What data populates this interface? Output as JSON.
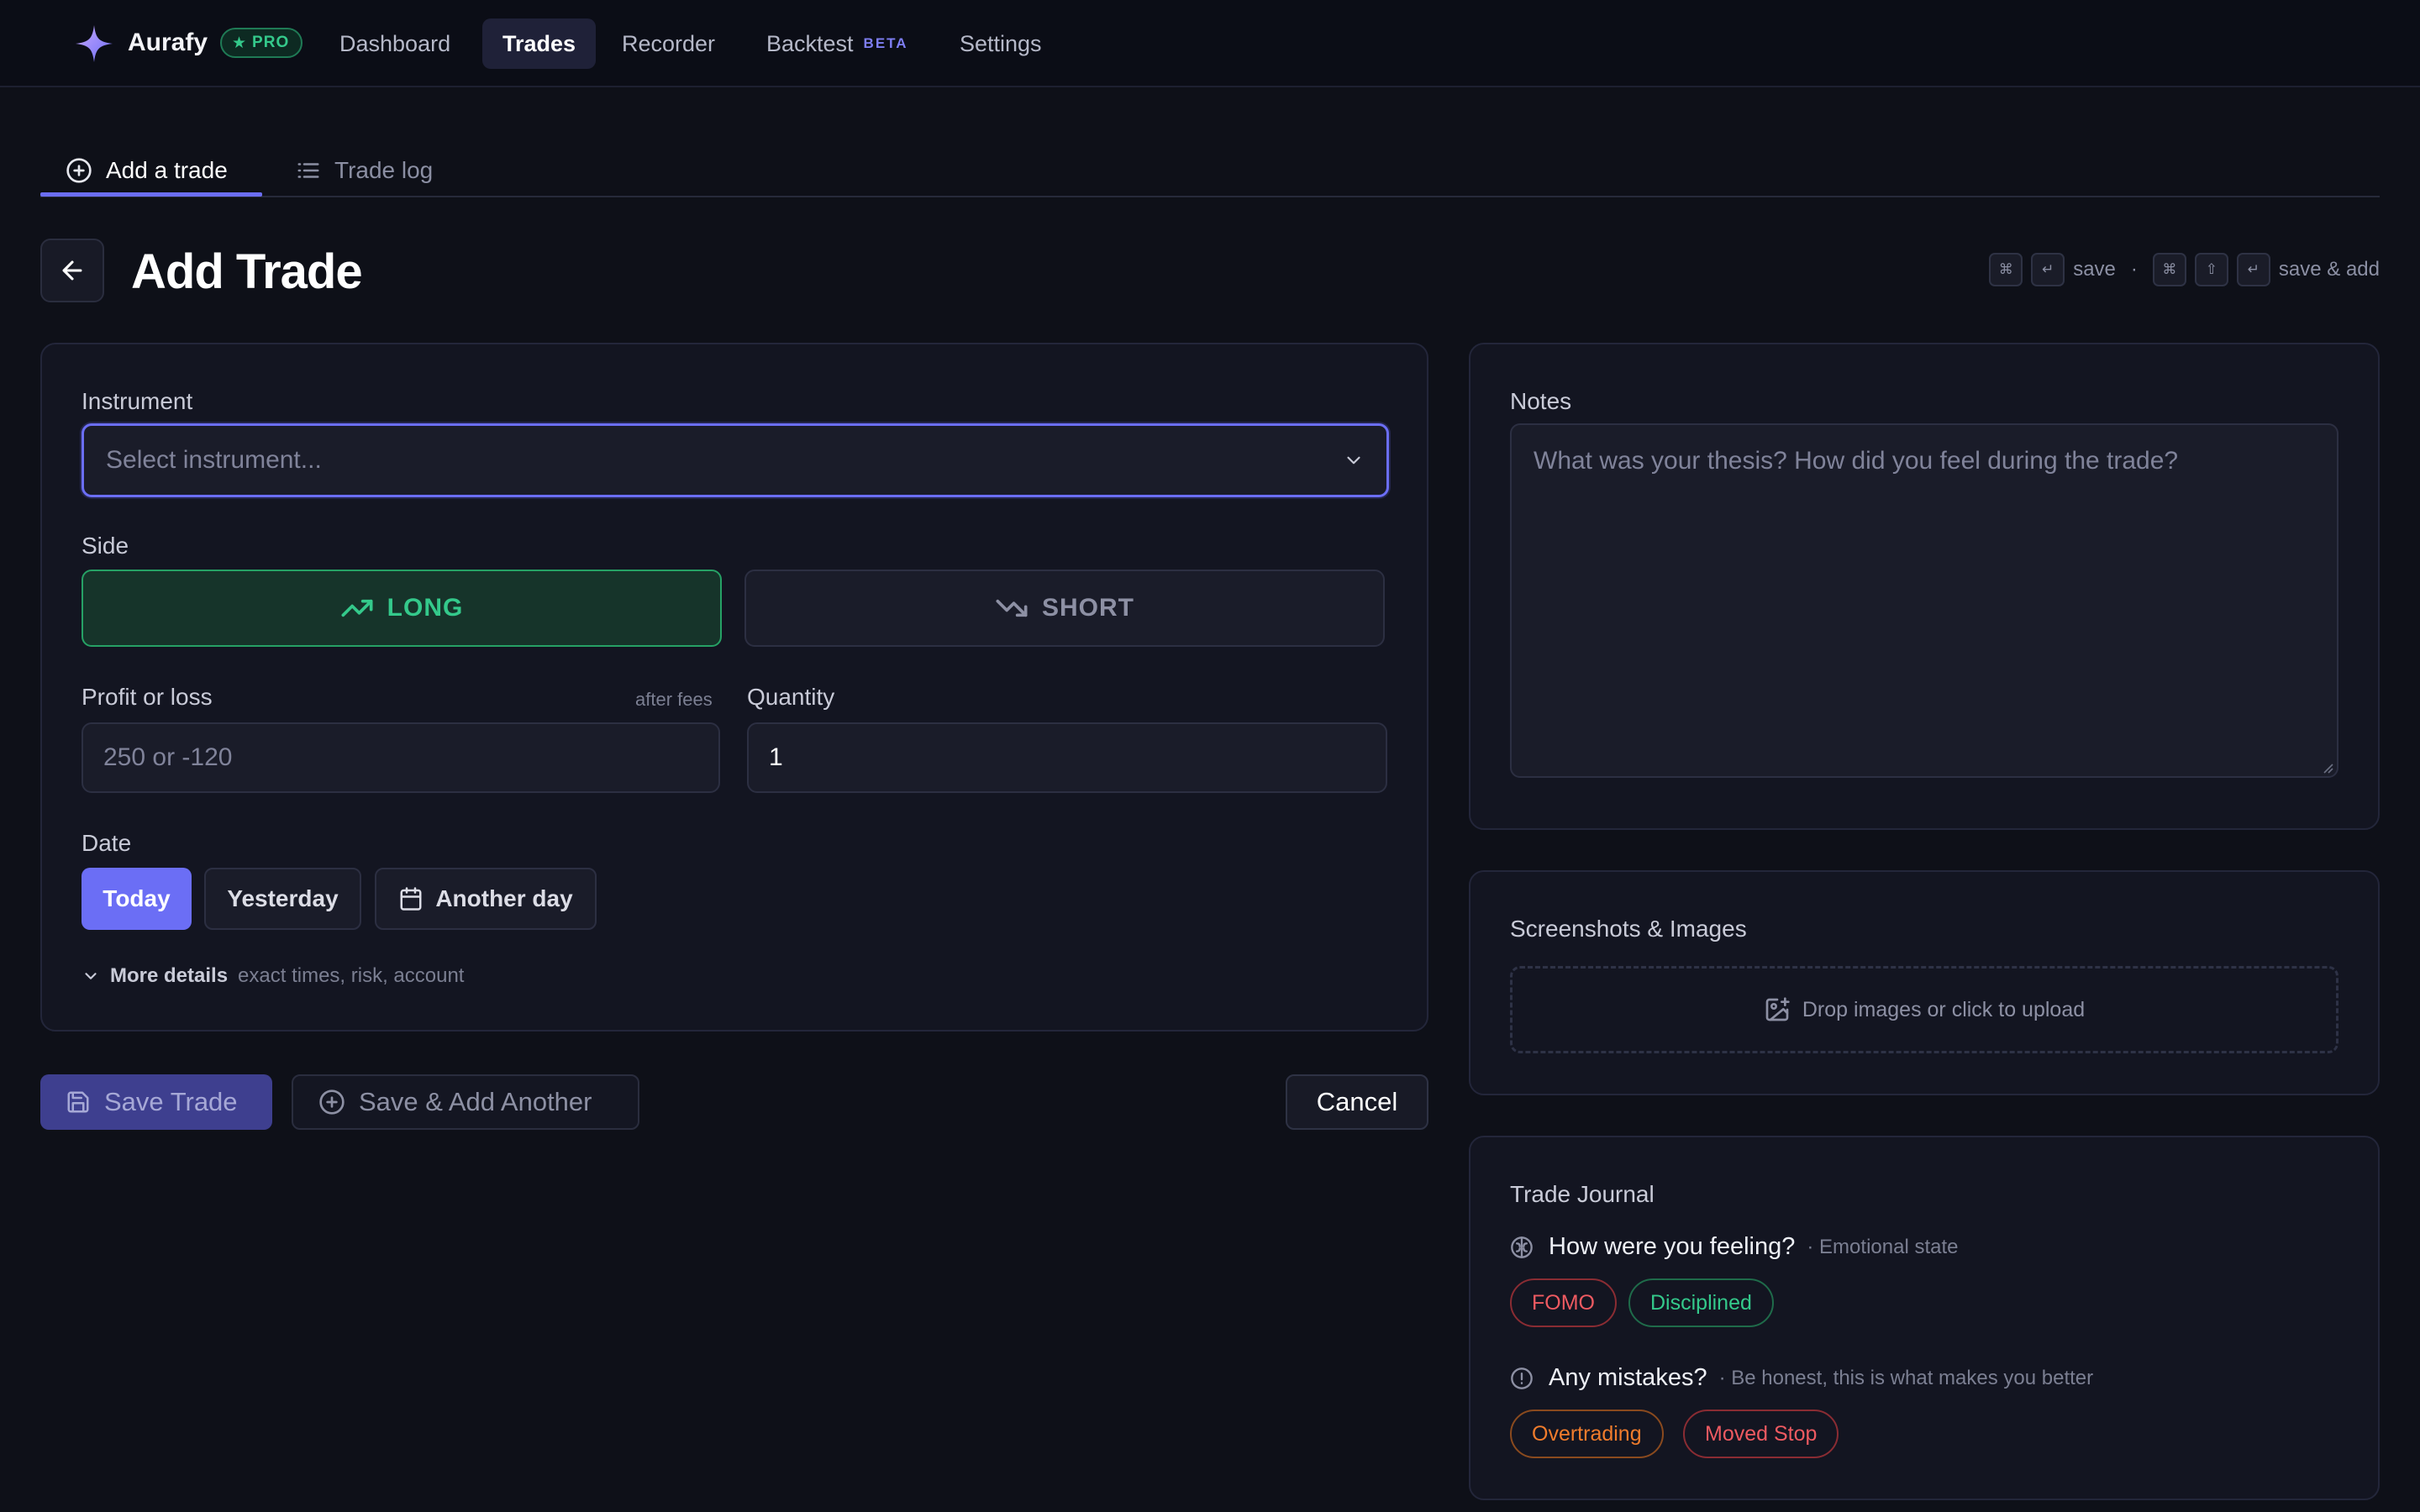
{
  "app": {
    "brand": "Aurafy",
    "plan_badge": "PRO",
    "nav": [
      {
        "label": "Dashboard"
      },
      {
        "label": "Trades"
      },
      {
        "label": "Recorder"
      },
      {
        "label": "Backtest",
        "tag": "BETA"
      },
      {
        "label": "Settings"
      }
    ],
    "active_nav": "Trades"
  },
  "tabs": [
    {
      "label": "Add a trade",
      "icon": "plus-circle-icon"
    },
    {
      "label": "Trade log",
      "icon": "list-icon"
    }
  ],
  "header": {
    "title": "Add Trade",
    "shortcut_save": "save",
    "shortcut_separator": "·",
    "shortcut_save_add": "save & add",
    "keys_save": [
      "⌘",
      "↵"
    ],
    "keys_save_add": [
      "⌘",
      "⇧",
      "↵"
    ]
  },
  "form": {
    "instrument_label": "Instrument",
    "instrument_placeholder": "Select instrument...",
    "side_label": "Side",
    "side_long": "LONG",
    "side_short": "SHORT",
    "pnl_label": "Profit or loss",
    "pnl_hint": "after fees",
    "pnl_placeholder": "250 or -120",
    "quantity_label": "Quantity",
    "quantity_value": "1",
    "date_label": "Date",
    "date_today": "Today",
    "date_yesterday": "Yesterday",
    "date_another": "Another day",
    "more_details": "More details",
    "more_details_hint": "exact times, risk, account"
  },
  "actions": {
    "save": "Save Trade",
    "save_add": "Save & Add Another",
    "cancel": "Cancel"
  },
  "notes": {
    "label": "Notes",
    "placeholder": "What was your thesis? How did you feel during the trade?"
  },
  "images": {
    "label": "Screenshots & Images",
    "dropzone": "Drop images or click to upload"
  },
  "journal": {
    "label": "Trade Journal",
    "feeling_q": "How were you feeling?",
    "feeling_hint": "· Emotional state",
    "feeling_chips": [
      "FOMO",
      "Disciplined"
    ],
    "mistakes_q": "Any mistakes?",
    "mistakes_hint": "· Be honest, this is what makes you better",
    "mistake_chips": [
      "Overtrading",
      "Moved Stop"
    ]
  },
  "colors": {
    "accent": "#6b6ef5",
    "long": "#34c98b",
    "danger": "#e5484d",
    "warning": "#f07c2c"
  }
}
